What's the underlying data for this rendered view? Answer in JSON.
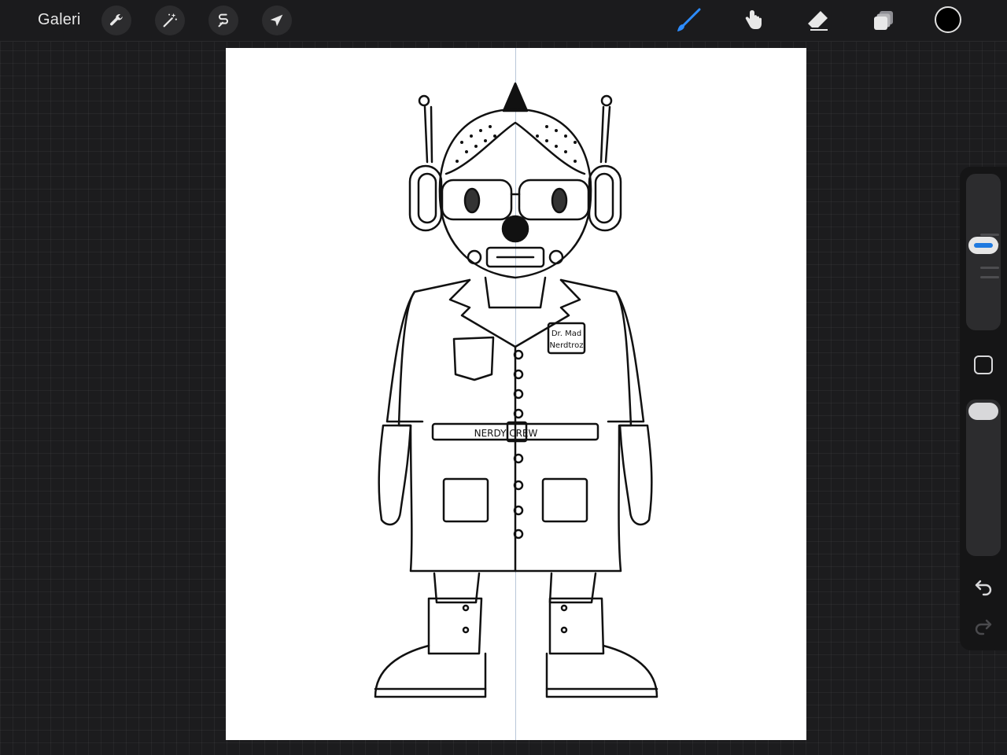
{
  "topbar": {
    "gallery_label": "Galeri",
    "left_tools": [
      {
        "name": "wrench-icon",
        "label": "Actions"
      },
      {
        "name": "magic-wand-icon",
        "label": "Adjustments"
      },
      {
        "name": "selection-icon",
        "label": "Selection"
      },
      {
        "name": "move-arrow-icon",
        "label": "Transform"
      }
    ],
    "right_tools": [
      {
        "name": "brush-icon",
        "active": true,
        "color": "#2d8cff"
      },
      {
        "name": "smudge-icon",
        "active": false
      },
      {
        "name": "eraser-icon",
        "active": false
      },
      {
        "name": "layers-icon",
        "active": false
      }
    ],
    "current_color": "#000000"
  },
  "canvas": {
    "background": "#ffffff",
    "drawing_guide": "vertical-symmetry",
    "artwork_labels": {
      "name_tag_line1": "Dr. Mad",
      "name_tag_line2": "Nerdtroz",
      "belt_text": "NERDY CREW"
    }
  },
  "sidebar": {
    "brush_size_level": 0.55,
    "brush_opacity_level": 1.0,
    "icons": [
      "modify-square-icon",
      "undo-icon",
      "redo-icon"
    ],
    "redo_enabled": false
  }
}
